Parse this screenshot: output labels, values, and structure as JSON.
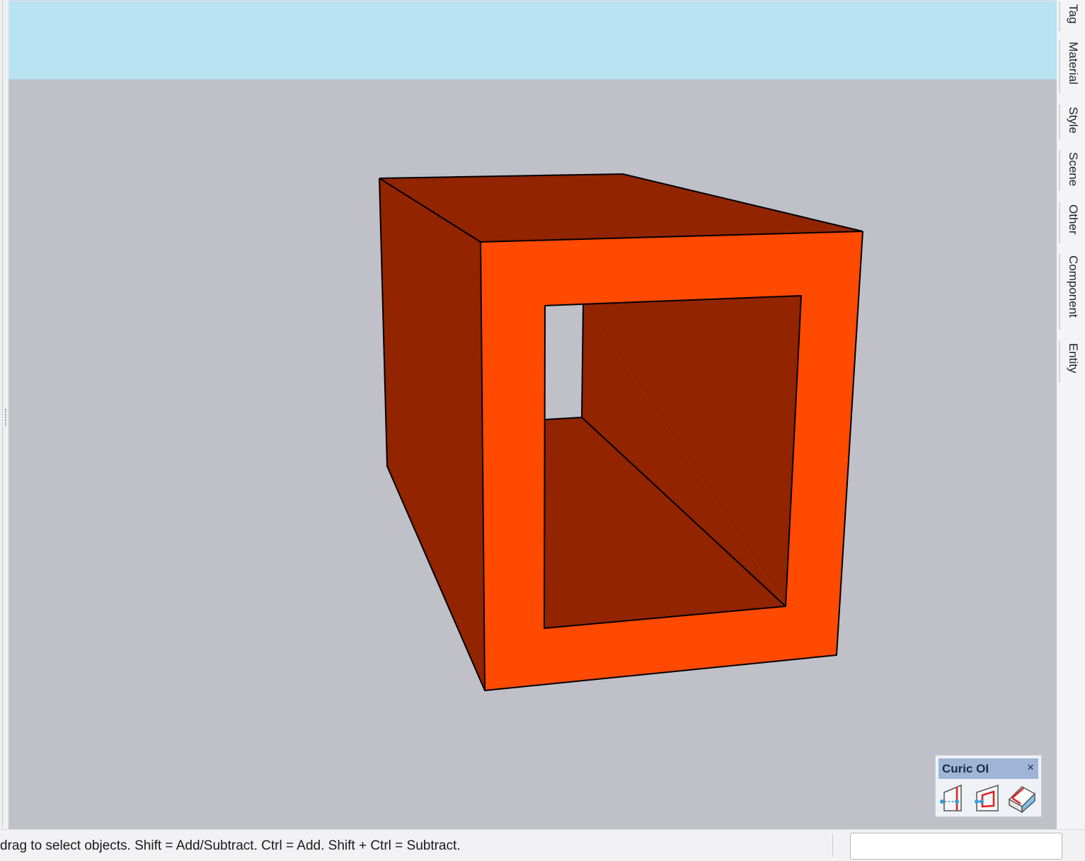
{
  "colors": {
    "sky": "#b9e2f2",
    "ground": "#c0c0c8",
    "front_face": "#ff4a00",
    "side_face": "#922400",
    "edge": "#000000"
  },
  "tray": {
    "tabs": [
      {
        "label": "Tag"
      },
      {
        "label": "Material"
      },
      {
        "label": "Style"
      },
      {
        "label": "Scene"
      },
      {
        "label": "Other"
      },
      {
        "label": "Component"
      },
      {
        "label": "Entity"
      }
    ]
  },
  "curic_toolbar": {
    "title": "Curic OI",
    "close_glyph": "×",
    "tools": [
      {
        "icon": "offset-edge-icon"
      },
      {
        "icon": "offset-face-icon"
      },
      {
        "icon": "offset-solid-icon"
      }
    ]
  },
  "status_bar": {
    "hint": "drag to select objects. Shift = Add/Subtract. Ctrl = Add. Shift + Ctrl = Subtract.",
    "measurements_value": ""
  }
}
